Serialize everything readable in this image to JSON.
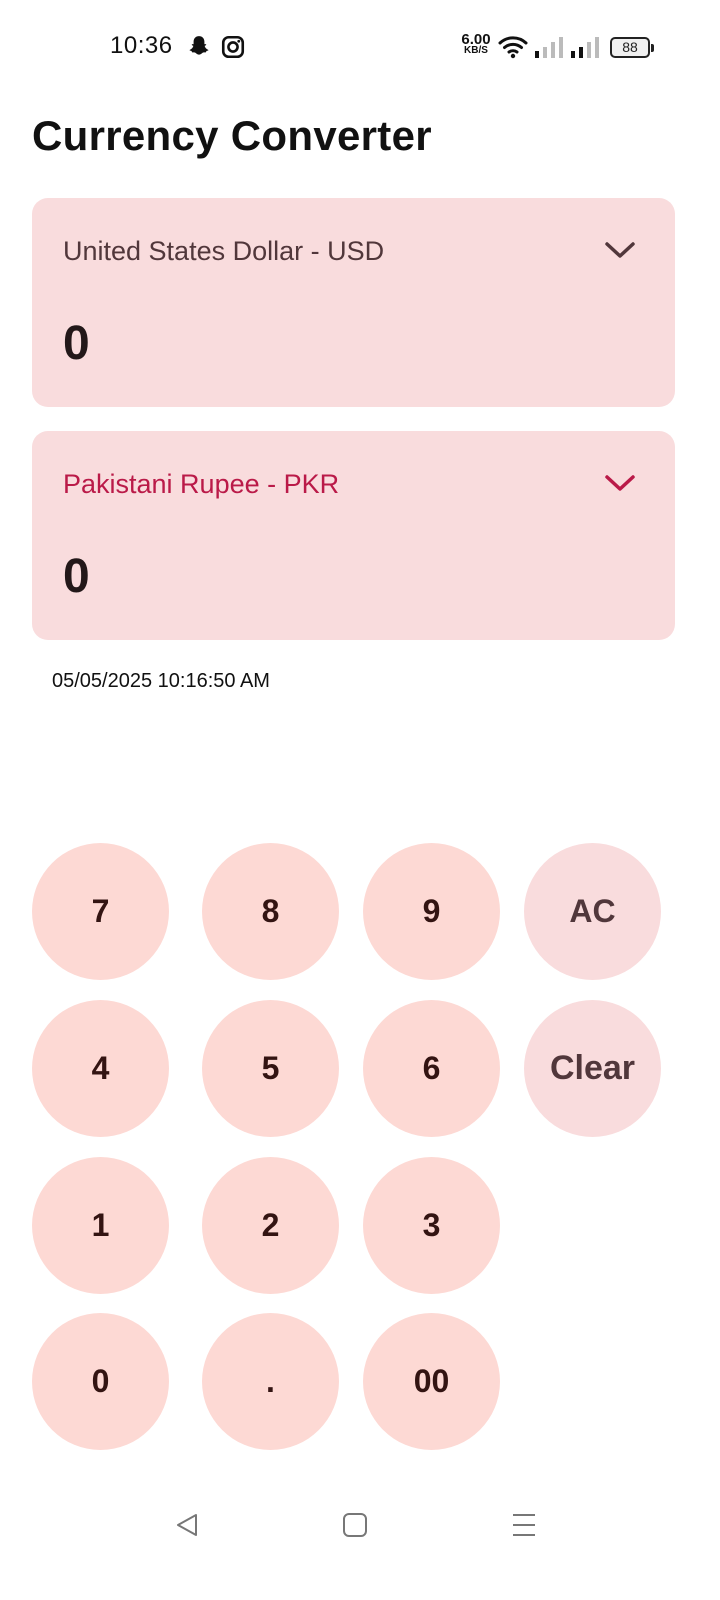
{
  "status_bar": {
    "time": "10:36",
    "net_speed_value": "6.00",
    "net_speed_unit": "KB/S",
    "battery": "88",
    "icons": [
      "snapchat-icon",
      "instagram-icon",
      "wifi-icon",
      "signal-icon",
      "signal-icon",
      "battery-icon"
    ]
  },
  "app": {
    "title": "Currency Converter"
  },
  "from_currency": {
    "label": "United States Dollar - USD",
    "value": "0"
  },
  "to_currency": {
    "label": "Pakistani Rupee - PKR",
    "value": "0"
  },
  "timestamp": "05/05/2025 10:16:50 AM",
  "keypad": {
    "k7": "7",
    "k8": "8",
    "k9": "9",
    "ac": "AC",
    "k4": "4",
    "k5": "5",
    "k6": "6",
    "clear": "Clear",
    "k1": "1",
    "k2": "2",
    "k3": "3",
    "k0": "0",
    "dot": ".",
    "k00": "00"
  },
  "colors": {
    "card_bg": "#f9dcdd",
    "key_bg": "#fdd9d4",
    "accent": "#ba1a48",
    "label": "#51373b"
  }
}
